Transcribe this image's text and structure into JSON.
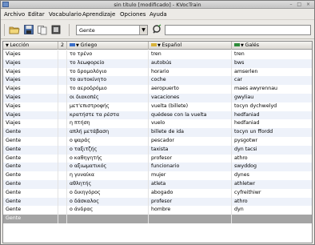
{
  "window": {
    "title": "sin título [modificado] - KVocTrain",
    "controls": "– □ ×"
  },
  "menu": [
    "Archivo",
    "Editar",
    "Vocabulario",
    "Aprendizaje",
    "Opciones",
    "Ayuda"
  ],
  "toolbar": {
    "icons": [
      "open-folder-icon",
      "save-icon",
      "copy-icon",
      "lesson-icon",
      "search-icon"
    ],
    "lesson_selected": "Gente",
    "search_value": ""
  },
  "table": {
    "headers": {
      "lesson": "Lección",
      "state": "2",
      "greek": "Griego",
      "spanish": "Español",
      "welsh": "Galés"
    },
    "rows": [
      {
        "lesson": "Viajes",
        "greek": "το τρένο",
        "spanish": "tren",
        "welsh": "tren"
      },
      {
        "lesson": "Viajes",
        "greek": "το λεωφορείο",
        "spanish": "autobús",
        "welsh": "bws"
      },
      {
        "lesson": "Viajes",
        "greek": "το δρομολόγιο",
        "spanish": "horario",
        "welsh": "amserlen"
      },
      {
        "lesson": "Viajes",
        "greek": "το αυτοκίνητο",
        "spanish": "coche",
        "welsh": "car"
      },
      {
        "lesson": "Viajes",
        "greek": "το αεροδρόμιο",
        "spanish": "aeropuerto",
        "welsh": "maes awyrennau"
      },
      {
        "lesson": "Viajes",
        "greek": "οι διακοπές",
        "spanish": "vacaciones",
        "welsh": "gwyliau"
      },
      {
        "lesson": "Viajes",
        "greek": "μετ'επιστροφής",
        "spanish": "vuelta (billete)",
        "welsh": "tocyn dychwelyd"
      },
      {
        "lesson": "Viajes",
        "greek": "κρατήστε τα ρέστα",
        "spanish": "quédese con la vuelta",
        "welsh": "hedfaniad"
      },
      {
        "lesson": "Viajes",
        "greek": "η πτήση",
        "spanish": "vuelo",
        "welsh": "hedfaniad"
      },
      {
        "lesson": "Gente",
        "greek": "απλή μετάβαση",
        "spanish": "billete de ida",
        "welsh": "tocyn un ffordd"
      },
      {
        "lesson": "Gente",
        "greek": "ο ψαράς",
        "spanish": "pescador",
        "welsh": "pysgotwr"
      },
      {
        "lesson": "Gente",
        "greek": "ο ταξιτζής",
        "spanish": "taxista",
        "welsh": "dyn tacsi"
      },
      {
        "lesson": "Gente",
        "greek": "ο καθηγητής",
        "spanish": "profesor",
        "welsh": "athro"
      },
      {
        "lesson": "Gente",
        "greek": "ο αξιωματικός",
        "spanish": "funcionario",
        "welsh": "swyddog"
      },
      {
        "lesson": "Gente",
        "greek": "η γυναίκα",
        "spanish": "mujer",
        "welsh": "dynes"
      },
      {
        "lesson": "Gente",
        "greek": "αθλητής",
        "spanish": "atleta",
        "welsh": "athletwr"
      },
      {
        "lesson": "Gente",
        "greek": "ο δικηγόρος",
        "spanish": "abogado",
        "welsh": "cyfreithiwr"
      },
      {
        "lesson": "Gente",
        "greek": "ο δάσκαλος",
        "spanish": "profesor",
        "welsh": "athro"
      },
      {
        "lesson": "Gente",
        "greek": "ο άνδρας",
        "spanish": "hombre",
        "welsh": "dyn"
      },
      {
        "lesson": "Gente",
        "greek": "",
        "spanish": "",
        "welsh": "",
        "selected": true
      }
    ]
  }
}
